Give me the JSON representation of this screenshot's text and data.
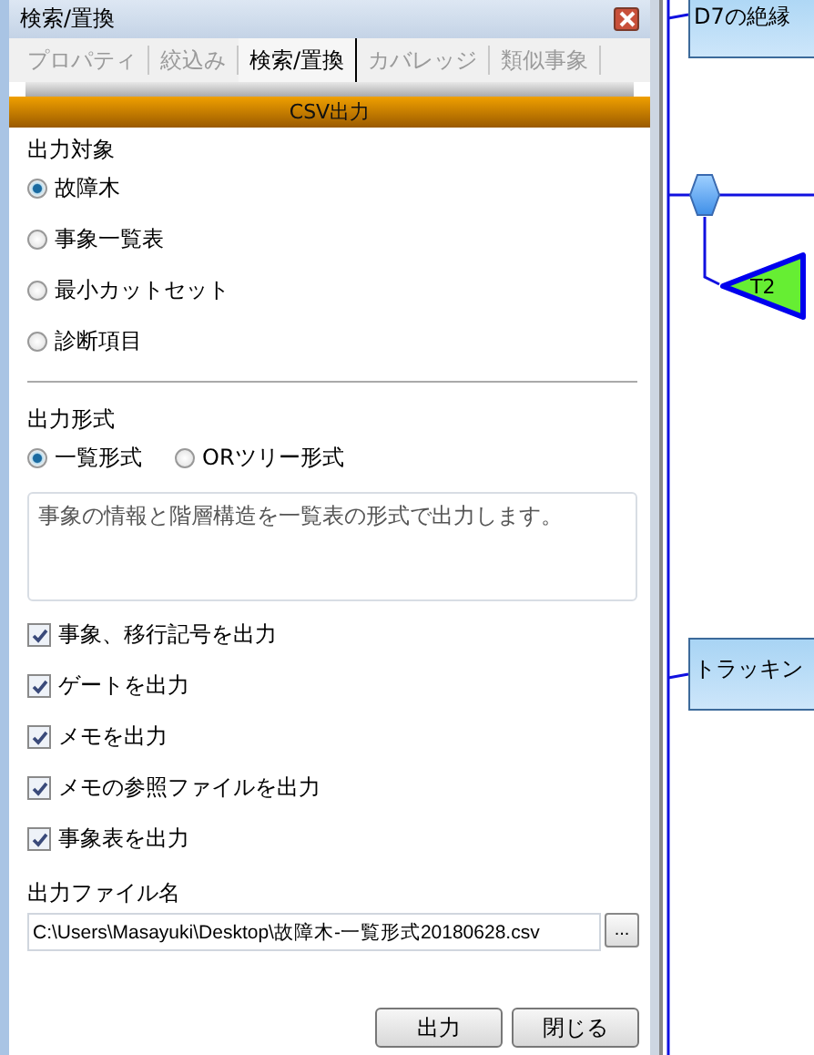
{
  "panel": {
    "title": "検索/置換"
  },
  "tabs": [
    {
      "label": "プロパティ",
      "selected": false
    },
    {
      "label": "絞込み",
      "selected": false
    },
    {
      "label": "検索/置換",
      "selected": true
    },
    {
      "label": "カバレッジ",
      "selected": false
    },
    {
      "label": "類似事象",
      "selected": false
    }
  ],
  "section_bar": "CSV出力",
  "target": {
    "label": "出力対象",
    "options": [
      {
        "label": "故障木",
        "selected": true
      },
      {
        "label": "事象一覧表",
        "selected": false
      },
      {
        "label": "最小カットセット",
        "selected": false
      },
      {
        "label": "診断項目",
        "selected": false
      }
    ]
  },
  "format": {
    "label": "出力形式",
    "options": [
      {
        "label": "一覧形式",
        "selected": true
      },
      {
        "label": "ORツリー形式",
        "selected": false
      }
    ]
  },
  "description": "事象の情報と階層構造を一覧表の形式で出力します。",
  "checks": [
    {
      "label": "事象、移行記号を出力",
      "checked": true
    },
    {
      "label": "ゲートを出力",
      "checked": true
    },
    {
      "label": "メモを出力",
      "checked": true
    },
    {
      "label": "メモの参照ファイルを出力",
      "checked": true
    },
    {
      "label": "事象表を出力",
      "checked": true
    }
  ],
  "file": {
    "label": "出力ファイル名",
    "value": "C:\\Users\\Masayuki\\Desktop\\故障木-一覧形式20180628.csv",
    "browse": "..."
  },
  "buttons": [
    "出力",
    "閉じる"
  ],
  "canvas": {
    "nodes": [
      {
        "kind": "event",
        "label": "D7の絶縁"
      },
      {
        "kind": "gate"
      },
      {
        "kind": "transfer",
        "label": "T2"
      },
      {
        "kind": "event",
        "label": "トラッキン"
      }
    ]
  }
}
